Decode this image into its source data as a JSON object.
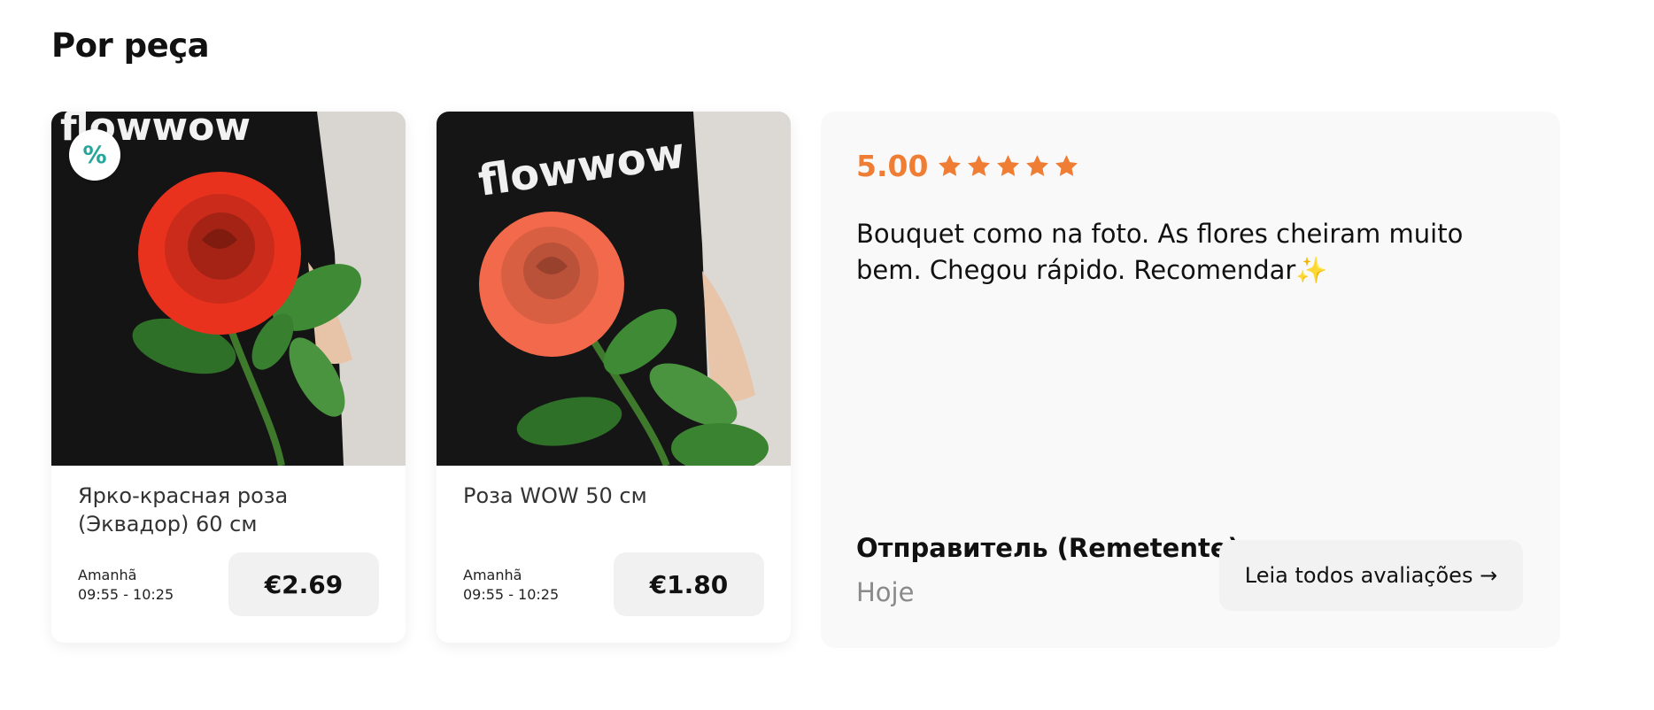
{
  "section": {
    "title": "Por peça"
  },
  "products": [
    {
      "brand_text": "flowwow",
      "discount_badge": "%",
      "name": "Ярко-красная роза (Эквадор) 60 см",
      "delivery_day": "Amanhã",
      "delivery_time": "09:55 - 10:25",
      "price": "€2.69",
      "rose_color": "#e8321e"
    },
    {
      "brand_text": "flowwow",
      "name": "Роза WOW 50 см",
      "delivery_day": "Amanhã",
      "delivery_time": "09:55 - 10:25",
      "price": "€1.80",
      "rose_color": "#f26a4b"
    }
  ],
  "review": {
    "rating": "5.00",
    "stars": 5,
    "text": "Bouquet como na foto. As flores cheiram muito bem. Chegou rápido. Recomendar",
    "text_emoji": "✨",
    "author": "Отправитель (Remetente)",
    "date": "Hoje",
    "all_reviews_label": "Leia todos avaliações →"
  },
  "colors": {
    "accent_rating": "#ef7d33",
    "discount_badge": "#26a69a",
    "price_button_bg": "#f1f1f1",
    "review_card_bg": "#f9f9f9"
  },
  "icons": {
    "star": "star-icon",
    "discount": "percent-icon",
    "arrow": "arrow-right-icon"
  }
}
